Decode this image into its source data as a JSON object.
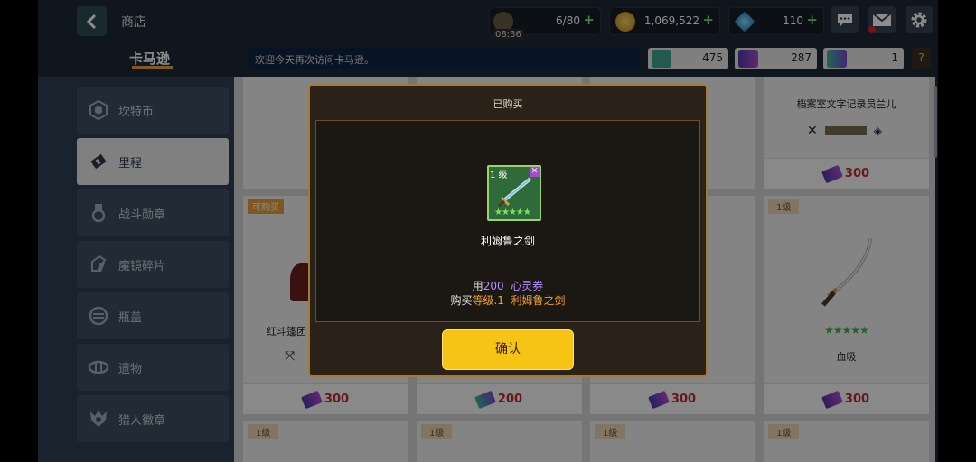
{
  "header": {
    "title": "商店",
    "stamina": {
      "value": "6/80",
      "timer": "08:36"
    },
    "gold": {
      "value": "1,069,522"
    },
    "gems": {
      "value": "110"
    }
  },
  "tab": {
    "label": "卡马逊"
  },
  "welcome_text": "欢迎今天再次访问卡马逊。",
  "tickets": [
    {
      "value": "475"
    },
    {
      "value": "287"
    },
    {
      "value": "1"
    }
  ],
  "help_label": "?",
  "sidebar": {
    "items": [
      {
        "label": "坎特币",
        "icon": "hexagon-coin-icon"
      },
      {
        "label": "里程",
        "icon": "ticket-icon"
      },
      {
        "label": "战斗勋章",
        "icon": "medal-icon"
      },
      {
        "label": "魔镜碎片",
        "icon": "mirror-shard-icon"
      },
      {
        "label": "瓶盖",
        "icon": "bottle-cap-icon"
      },
      {
        "label": "遗物",
        "icon": "relic-icon"
      },
      {
        "label": "猎人徽章",
        "icon": "hunter-badge-icon"
      }
    ],
    "active_index": 1
  },
  "shop": {
    "row1_last": {
      "name": "档案室文字记录员兰儿",
      "price": "300"
    },
    "row2": [
      {
        "tag": "可购买",
        "name": "红斗篷团",
        "price": "300"
      },
      {
        "price": "200"
      },
      {
        "price": "300"
      },
      {
        "tag": "1级",
        "name": "血吸",
        "price": "300"
      }
    ],
    "row3_tags": [
      "1级",
      "1级",
      "1级",
      "1级"
    ]
  },
  "modal": {
    "title": "已购买",
    "item_level": "1 级",
    "item_name": "利姆鲁之剑",
    "line1_prefix": "用",
    "line1_amount": "200",
    "line1_currency": "心灵券",
    "line2_prefix": "购买",
    "line2_level": "等级.1",
    "line2_item": "利姆鲁之剑",
    "confirm_label": "确认"
  },
  "colors": {
    "accent": "#f6c415",
    "price_red": "#c0282e",
    "modal_border": "#a37a3a"
  }
}
